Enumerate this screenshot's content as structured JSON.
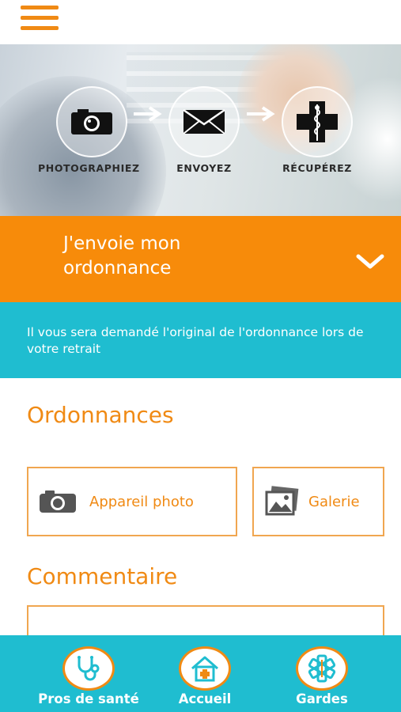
{
  "header": {
    "menu_icon": "hamburger-menu-icon",
    "accent": "#f08a14"
  },
  "hero": {
    "steps": [
      {
        "label": "PHOTOGRAPHIEZ",
        "icon": "camera-icon"
      },
      {
        "label": "ENVOYEZ",
        "icon": "envelope-icon"
      },
      {
        "label": "RÉCUPÉREZ",
        "icon": "pharmacy-cross-icon"
      }
    ]
  },
  "banner": {
    "title": "J'envoie mon ordonnance",
    "icon": "chevron-down-icon",
    "color": "#f78b0a"
  },
  "info": {
    "text": "Il vous sera demandé l'original de l'ordonnance lors de votre retrait",
    "color": "#1fbdd0"
  },
  "ordonnances": {
    "title": "Ordonnances",
    "camera_label": "Appareil photo",
    "gallery_label": "Galerie"
  },
  "comment": {
    "title": "Commentaire",
    "value": ""
  },
  "tabbar": {
    "tabs": [
      {
        "label": "Pros de santé",
        "icon": "stethoscope-icon"
      },
      {
        "label": "Accueil",
        "icon": "home-icon"
      },
      {
        "label": "Gardes",
        "icon": "medical-star-icon"
      }
    ]
  }
}
